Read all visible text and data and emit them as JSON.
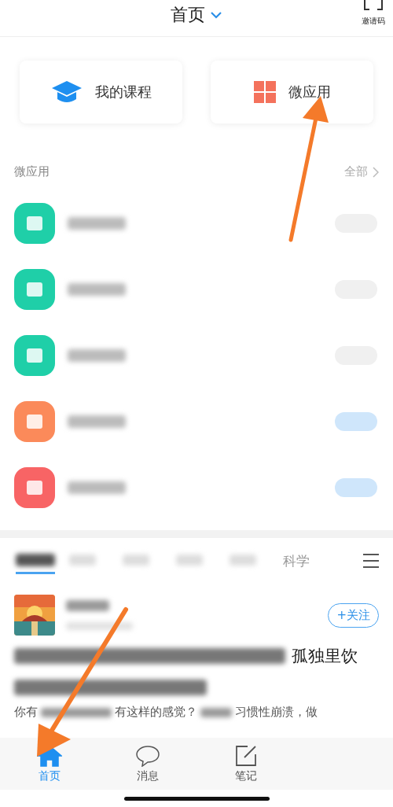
{
  "header": {
    "title": "首页",
    "invite_label": "邀请码"
  },
  "shortcuts": [
    {
      "label": "我的课程",
      "kind": "cap"
    },
    {
      "label": "微应用",
      "kind": "grid"
    }
  ],
  "section": {
    "title": "微应用",
    "more": "全部"
  },
  "apps": [
    {
      "color": "#1fcfa8",
      "added": true
    },
    {
      "color": "#1fcfa8",
      "added": true
    },
    {
      "color": "#1fcfa8",
      "added": true
    },
    {
      "color": "#fb8a5a",
      "added": false
    },
    {
      "color": "#f86465",
      "added": false
    }
  ],
  "feed_tabs": [
    {
      "selected": true
    },
    {
      "selected": false
    },
    {
      "selected": false
    },
    {
      "selected": false
    },
    {
      "selected": false
    },
    {
      "label": "科学",
      "selected": false
    }
  ],
  "article": {
    "follow": "+关注",
    "title_visible": "孤独里饮",
    "description_parts": [
      "你有",
      "有这样的感觉？",
      "习惯性崩溃，做"
    ]
  },
  "tab_bar": [
    {
      "label": "首页",
      "kind": "home",
      "selected": true
    },
    {
      "label": "消息",
      "kind": "chat",
      "selected": false
    },
    {
      "label": "笔记",
      "kind": "note",
      "selected": false
    }
  ]
}
